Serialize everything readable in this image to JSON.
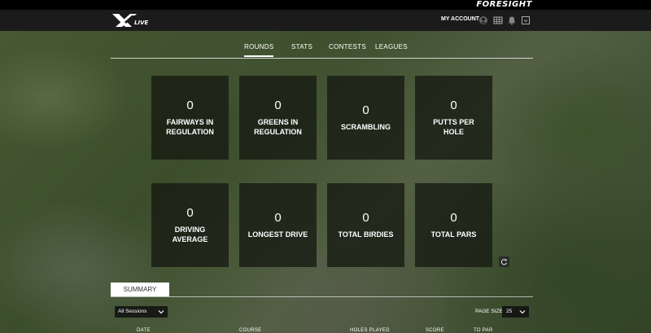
{
  "brand": {
    "name": "FORESIGHT"
  },
  "app": {
    "logo_text": "XLIVE"
  },
  "header": {
    "account_label": "MY ACCOUNT",
    "icons": [
      "account-icon",
      "grid-icon",
      "bell-icon",
      "logout-icon"
    ]
  },
  "tabs": [
    {
      "label": "ROUNDS",
      "active": true
    },
    {
      "label": "STATS",
      "active": false
    },
    {
      "label": "CONTESTS",
      "active": false
    },
    {
      "label": "LEAGUES",
      "active": false
    }
  ],
  "stats": [
    {
      "value": "0",
      "label": "FAIRWAYS IN\nREGULATION"
    },
    {
      "value": "0",
      "label": "GREENS IN\nREGULATION"
    },
    {
      "value": "0",
      "label": "SCRAMBLING"
    },
    {
      "value": "0",
      "label": "PUTTS PER\nHOLE"
    },
    {
      "value": "0",
      "label": "DRIVING\nAVERAGE"
    },
    {
      "value": "0",
      "label": "LONGEST DRIVE"
    },
    {
      "value": "0",
      "label": "TOTAL BIRDIES"
    },
    {
      "value": "0",
      "label": "TOTAL PARS"
    }
  ],
  "summary": {
    "tab_label": "SUMMARY",
    "sessions_filter": "All Sessions",
    "page_size_label": "PAGE SIZE",
    "page_size_value": "25",
    "columns": [
      "DATE",
      "COURSE",
      "HOLES PLAYED",
      "SCORE",
      "TO PAR"
    ]
  },
  "colors": {
    "header_bg": "#1b1b1b",
    "card_bg": "#16191299",
    "accent": "#ffffff"
  }
}
